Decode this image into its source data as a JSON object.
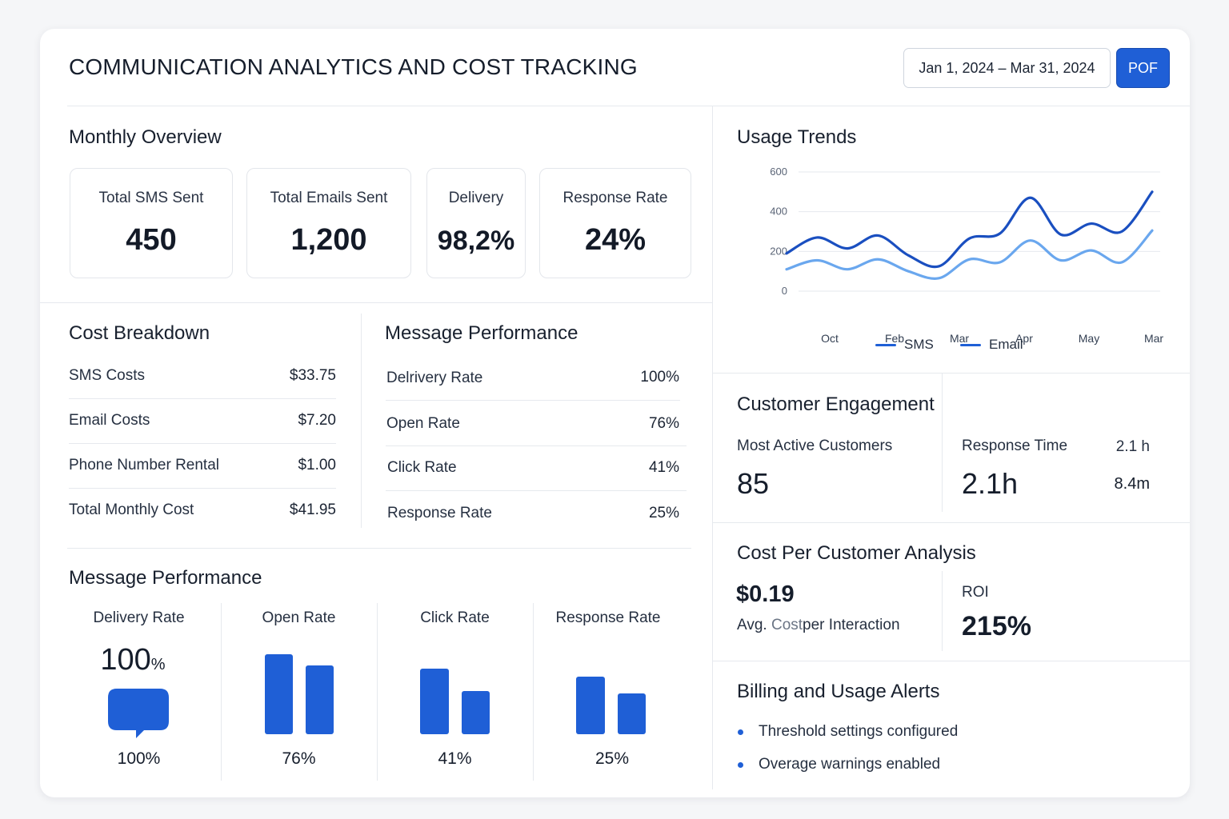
{
  "header": {
    "title": "COMMUNICATION ANALYTICS AND COST TRACKING",
    "date_range": "Jan 1, 2024  –  Mar 31, 2024",
    "pdf_label": "POF"
  },
  "monthly_overview": {
    "title": "Monthly Overview",
    "stats": [
      {
        "label": "Total SMS Sent",
        "value": "450"
      },
      {
        "label": "Total Emails Sent",
        "value": "1,200"
      },
      {
        "label": "Delivery",
        "value": "98,2%"
      },
      {
        "label": "Response Rate",
        "value": "24%"
      }
    ]
  },
  "cost_breakdown": {
    "title": "Cost Breakdown",
    "rows": [
      {
        "label": "SMS Costs",
        "value": "$33.75"
      },
      {
        "label": "Email Costs",
        "value": "$7.20"
      },
      {
        "label": "Phone Number Rental",
        "value": "$1.00"
      },
      {
        "label": "Total Monthly Cost",
        "value": "$41.95"
      }
    ]
  },
  "message_performance_table": {
    "title": "Message Performance",
    "rows": [
      {
        "label": "Delrivery Rate",
        "value": "100%"
      },
      {
        "label": "Open Rate",
        "value": "76%"
      },
      {
        "label": "Click Rate",
        "value": "41%"
      },
      {
        "label": "Response Rate",
        "value": "25%"
      }
    ]
  },
  "message_performance_bars": {
    "title": "Message Performance",
    "delivery": {
      "label": "Delivery Rate",
      "big_value": "100",
      "big_unit": "%",
      "pct": "100%",
      "icon": "chat-bubble-icon"
    },
    "items": [
      {
        "label": "Open Rate",
        "pct": "76%",
        "bar_values": [
          100,
          86
        ]
      },
      {
        "label": "Click Rate",
        "pct": "41%",
        "bar_values": [
          82,
          54
        ]
      },
      {
        "label": "Response Rate",
        "pct": "25%",
        "bar_values": [
          72,
          51
        ]
      }
    ]
  },
  "usage_trends": {
    "title": "Usage Trends"
  },
  "chart_data": {
    "type": "line",
    "title": "Usage Trends",
    "xlabel": "",
    "ylabel": "",
    "ylim": [
      0,
      600
    ],
    "yticks": [
      "600",
      "400",
      "200",
      "0"
    ],
    "xticks": [
      "Oct",
      "Feb",
      "Mar",
      "Apr",
      "May",
      "Mar"
    ],
    "x": [
      0,
      0.5,
      1,
      1.5,
      2,
      2.5,
      3,
      3.5,
      4,
      4.5,
      5,
      5.5,
      6
    ],
    "series": [
      {
        "name": "SMS",
        "color": "#1a4fc0",
        "values": [
          190,
          270,
          215,
          280,
          180,
          125,
          265,
          290,
          470,
          285,
          340,
          300,
          500
        ]
      },
      {
        "name": "Email",
        "color": "#6aa7ee",
        "values": [
          110,
          155,
          110,
          160,
          100,
          65,
          160,
          145,
          255,
          155,
          205,
          145,
          305
        ]
      }
    ],
    "grid": true,
    "legend": "bottom-center"
  },
  "customer_engagement": {
    "title": "Customer Engagement",
    "most_active_label": "Most Active Customers",
    "most_active_value": "85",
    "response_time_label": "Response Time",
    "response_time_small": "2.1 h",
    "response_time_value": "2.1h",
    "secondary_value": "8.4m"
  },
  "cost_per_customer": {
    "title": "Cost Per Customer Analysis",
    "avg_value": "$0.19",
    "avg_label_part1": "Avg.",
    "avg_label_part2": "Cost",
    "avg_label_part3": "per Interaction",
    "roi_label": "ROI",
    "roi_value": "215%"
  },
  "billing_alerts": {
    "title": "Billing and Usage Alerts",
    "items": [
      "Threshold settings configured",
      "Overage warnings enabled"
    ]
  },
  "colors": {
    "accent": "#1f5fd6",
    "accent_light": "#6aa7ee"
  }
}
